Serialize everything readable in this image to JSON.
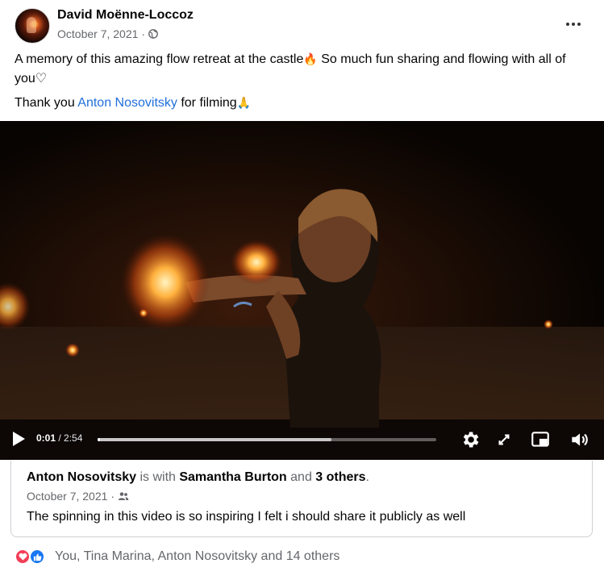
{
  "post": {
    "author_name": "David Moënne-Loccoz",
    "date": "October 7, 2021",
    "meta_separator": "·",
    "privacy_icon": "globe-icon",
    "more_icon": "more-options-icon",
    "text_line1_before": "A memory of this amazing flow retreat at the castle",
    "text_line1_emoji": "🔥",
    "text_line1_after": " So much fun sharing and flowing with all of you♡",
    "text_line2_before": "Thank you ",
    "text_line2_mention": "Anton Nosovitsky",
    "text_line2_after": " for filming",
    "text_line2_emoji": "🙏"
  },
  "video": {
    "current_time": "0:01",
    "total_time": " / 2:54",
    "progress_fraction": 0.006,
    "buffered_fraction": 0.69,
    "icons": [
      "play-icon",
      "settings-icon",
      "fullscreen-icon",
      "picture-in-picture-icon",
      "volume-icon"
    ]
  },
  "shared": {
    "author": "Anton Nosovitsky",
    "is_with": " is with ",
    "tagged": "Samantha Burton",
    "and": " and ",
    "others": "3 others",
    "period": ".",
    "date": "October 7, 2021",
    "meta_separator": " ·",
    "audience_icon": "friends-icon",
    "text": "The spinning in this video is so inspiring I felt i should share it publicly as well"
  },
  "reactions": {
    "icons": [
      "love-reaction-icon",
      "like-reaction-icon"
    ],
    "summary": "You, Tina Marina, Anton Nosovitsky and 14 others"
  },
  "colors": {
    "link": "#216fdb",
    "secondary_text": "#65676b",
    "like_blue": "#1877f2",
    "love_red": "#f33e58"
  }
}
